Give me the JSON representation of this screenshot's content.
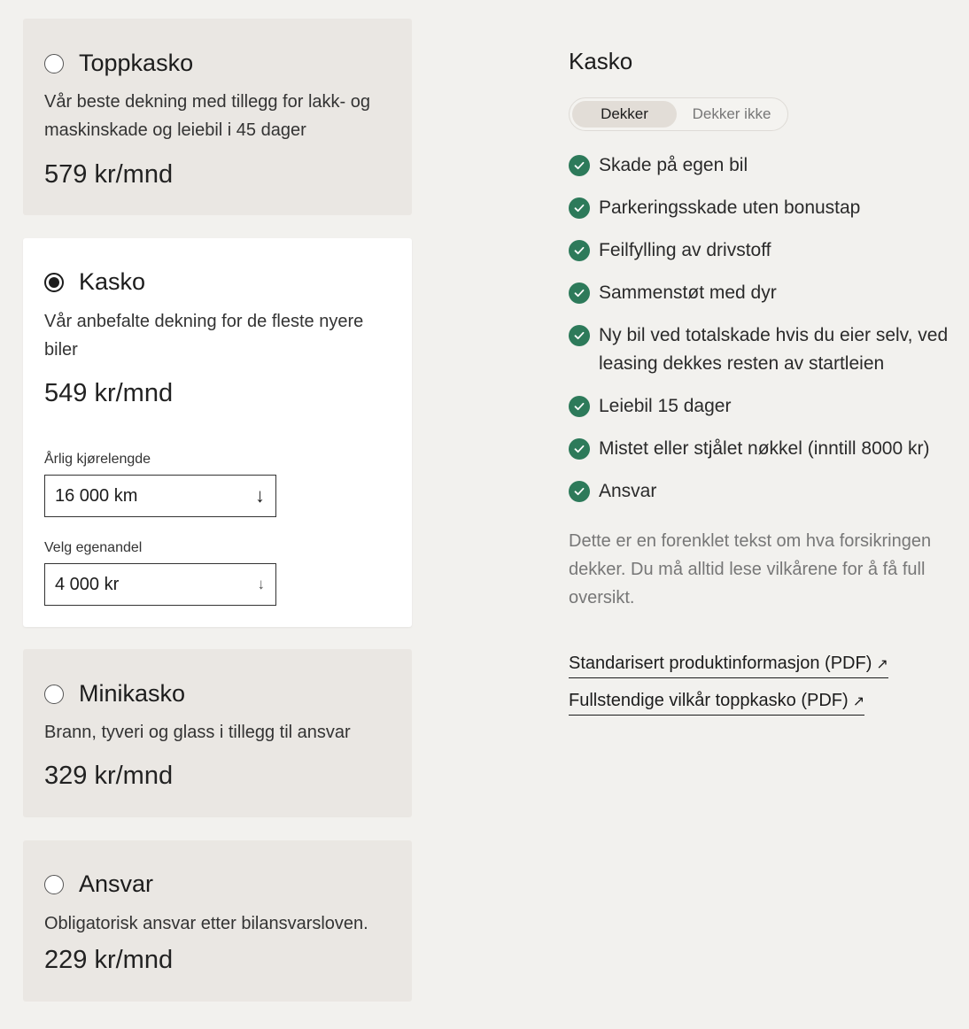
{
  "plans": [
    {
      "title": "Toppkasko",
      "description": "Vår beste dekning med tillegg for lakk- og maskinskade og leiebil i 45 dager",
      "price": "579 kr/mnd",
      "selected": false
    },
    {
      "title": "Kasko",
      "description": "Vår anbefalte dekning for de fleste nyere biler",
      "price": "549 kr/mnd",
      "selected": true,
      "mileage": {
        "label": "Årlig kjørelengde",
        "value": "16 000 km"
      },
      "deductible": {
        "label": "Velg egenandel",
        "value": "4 000 kr"
      }
    },
    {
      "title": "Minikasko",
      "description": "Brann, tyveri og glass i tillegg til ansvar",
      "price": "329 kr/mnd",
      "selected": false
    },
    {
      "title": "Ansvar",
      "description": "Obligatorisk ansvar etter bilansvarsloven.",
      "price": "229 kr/mnd",
      "selected": false
    }
  ],
  "coverage": {
    "title": "Kasko",
    "toggle": {
      "covers": "Dekker",
      "not_covers": "Dekker ikke",
      "active": "covers"
    },
    "items": [
      "Skade på egen bil",
      "Parkeringsskade uten bonustap",
      "Feilfylling av drivstoff",
      "Sammenstøt med dyr",
      "Ny bil ved totalskade hvis du eier selv, ved leasing dekkes resten av startleien",
      "Leiebil 15 dager",
      "Mistet eller stjålet nøkkel (inntill 8000 kr)",
      "Ansvar"
    ],
    "disclaimer": "Dette er en forenklet tekst om hva forsikringen dekker. Du må alltid lese vilkårene for å få full oversikt.",
    "links": [
      {
        "label": "Standarisert produktinformasjon (PDF)"
      },
      {
        "label": "Fullstendige vilkår toppkasko (PDF)"
      }
    ]
  },
  "colors": {
    "check": "#2d7a5a",
    "card_bg": "#eae7e3",
    "page_bg": "#f2f1ee"
  },
  "icons": {
    "check": "check-circle-icon",
    "select_arrow": "arrow-down-icon",
    "external": "external-link-icon"
  }
}
